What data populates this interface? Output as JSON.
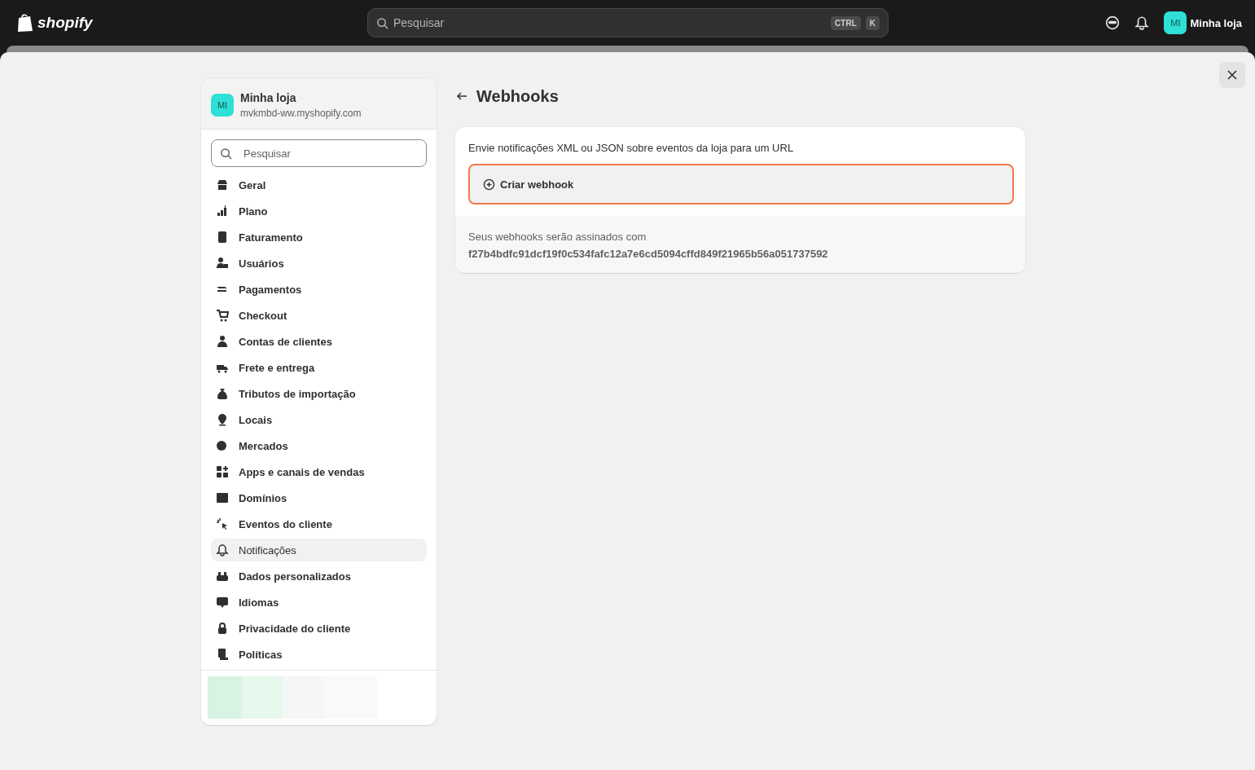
{
  "topbar": {
    "logo": "shopify",
    "search": {
      "placeholder": "Pesquisar",
      "shortcut": [
        "CTRL",
        "K"
      ]
    },
    "avatar": "MI",
    "store": "Minha loja"
  },
  "sidebar": {
    "store": {
      "avatar": "MI",
      "name": "Minha loja",
      "domain": "mvkmbd-ww.myshopify.com"
    },
    "search": {
      "placeholder": "Pesquisar"
    },
    "items": [
      {
        "label": "Geral",
        "selected": false
      },
      {
        "label": "Plano",
        "selected": false
      },
      {
        "label": "Faturamento",
        "selected": false
      },
      {
        "label": "Usuários",
        "selected": false
      },
      {
        "label": "Pagamentos",
        "selected": false
      },
      {
        "label": "Checkout",
        "selected": false
      },
      {
        "label": "Contas de clientes",
        "selected": false
      },
      {
        "label": "Frete e entrega",
        "selected": false
      },
      {
        "label": "Tributos de importação",
        "selected": false
      },
      {
        "label": "Locais",
        "selected": false
      },
      {
        "label": "Mercados",
        "selected": false
      },
      {
        "label": "Apps e canais de vendas",
        "selected": false
      },
      {
        "label": "Domínios",
        "selected": false
      },
      {
        "label": "Eventos do cliente",
        "selected": false
      },
      {
        "label": "Notificações",
        "selected": true
      },
      {
        "label": "Dados personalizados",
        "selected": false
      },
      {
        "label": "Idiomas",
        "selected": false
      },
      {
        "label": "Privacidade do cliente",
        "selected": false
      },
      {
        "label": "Políticas",
        "selected": false
      }
    ]
  },
  "page": {
    "title": "Webhooks",
    "card": {
      "description": "Envie notificações XML ou JSON sobre eventos da loja para um URL",
      "button": "Criar webhook",
      "footer_label": "Seus webhooks serão assinados com",
      "signature": "f27b4bdfc91dcf19f0c534fafc12a7e6cd5094cffd849f21965b56a051737592"
    }
  }
}
